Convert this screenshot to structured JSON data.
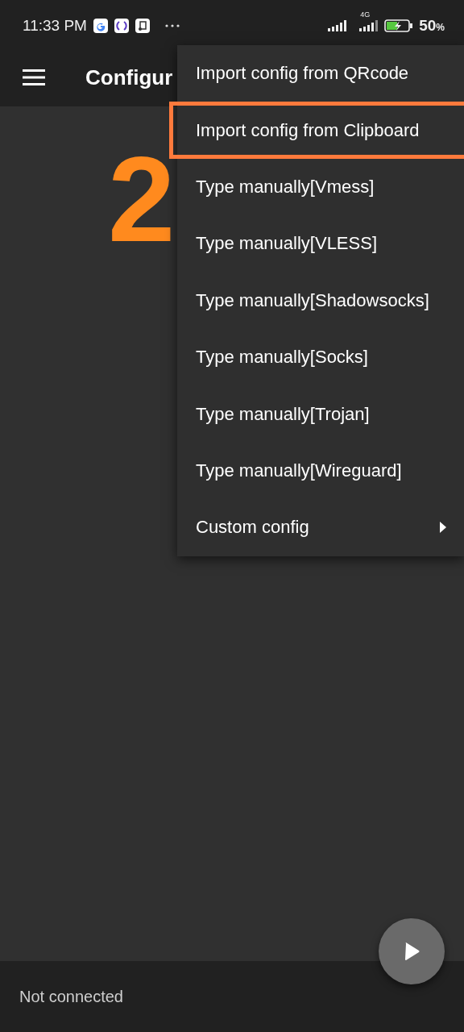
{
  "status_bar": {
    "time": "11:33 PM",
    "network": "4G",
    "battery": "50",
    "battery_unit": "%"
  },
  "app_bar": {
    "title": "Configur"
  },
  "annotation": {
    "label": "2"
  },
  "menu": {
    "items": [
      {
        "label": "Import config from QRcode",
        "kind": "action",
        "highlighted": false
      },
      {
        "label": "Import config from Clipboard",
        "kind": "action",
        "highlighted": true
      },
      {
        "label": "Type manually[Vmess]",
        "kind": "action",
        "highlighted": false
      },
      {
        "label": "Type manually[VLESS]",
        "kind": "action",
        "highlighted": false
      },
      {
        "label": "Type manually[Shadowsocks]",
        "kind": "action",
        "highlighted": false
      },
      {
        "label": "Type manually[Socks]",
        "kind": "action",
        "highlighted": false
      },
      {
        "label": "Type manually[Trojan]",
        "kind": "action",
        "highlighted": false
      },
      {
        "label": "Type manually[Wireguard]",
        "kind": "action",
        "highlighted": false
      },
      {
        "label": "Custom config",
        "kind": "submenu",
        "highlighted": false
      }
    ]
  },
  "footer": {
    "status": "Not connected"
  }
}
